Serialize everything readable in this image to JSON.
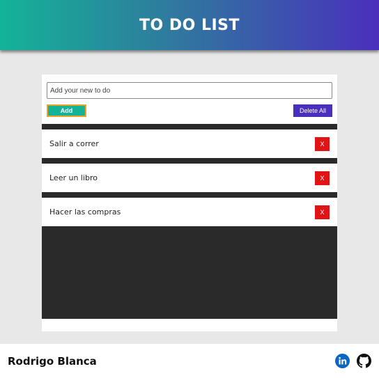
{
  "header": {
    "title": "TO DO LIST"
  },
  "form": {
    "input_placeholder": "Add your new to do",
    "add_label": "Add",
    "delete_all_label": "Delete All"
  },
  "todos": [
    {
      "text": "Salir a correr",
      "delete_label": "X"
    },
    {
      "text": "Leer un libro",
      "delete_label": "X"
    },
    {
      "text": "Hacer las compras",
      "delete_label": "X"
    }
  ],
  "footer": {
    "author": "Rodrigo Blanca",
    "icons": [
      "linkedin-icon",
      "github-icon"
    ]
  },
  "colors": {
    "gradient_start": "#14b398",
    "gradient_end": "#4a2fbd",
    "add_button": "#14b398",
    "delete_all_button": "#4a2fbd",
    "delete_item_button": "#e01414",
    "list_background": "#2a2a2a",
    "linkedin": "#0a66c2"
  }
}
